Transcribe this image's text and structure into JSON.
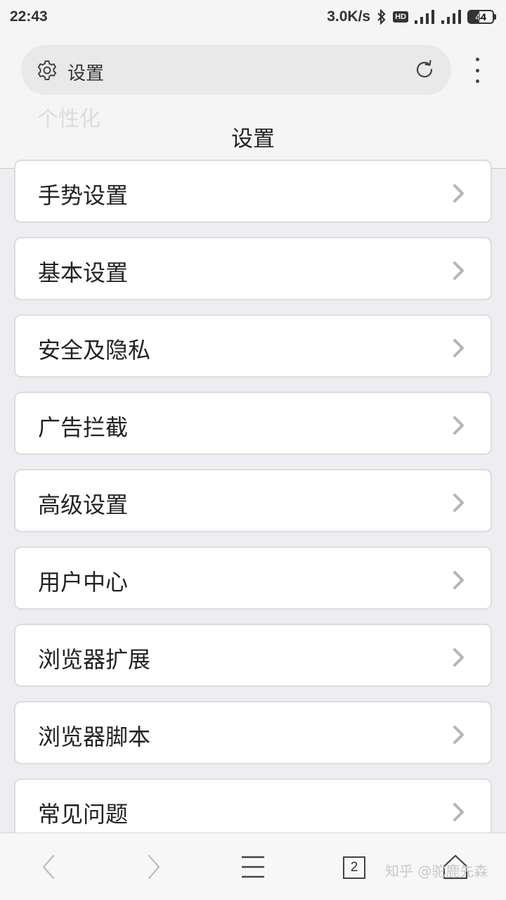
{
  "status_bar": {
    "time": "22:43",
    "speed": "3.0K/s",
    "hd": "HD",
    "battery": "44"
  },
  "address_bar": {
    "text": "设置"
  },
  "ghost_item": "个性化",
  "page_title": "设置",
  "settings_items": [
    {
      "label": "手势设置"
    },
    {
      "label": "基本设置"
    },
    {
      "label": "安全及隐私"
    },
    {
      "label": "广告拦截"
    },
    {
      "label": "高级设置"
    },
    {
      "label": "用户中心"
    },
    {
      "label": "浏览器扩展"
    },
    {
      "label": "浏览器脚本"
    },
    {
      "label": "常见问题"
    }
  ],
  "bottom_nav": {
    "tab_count": "2"
  },
  "watermark": "知乎 @驼鹿先森"
}
